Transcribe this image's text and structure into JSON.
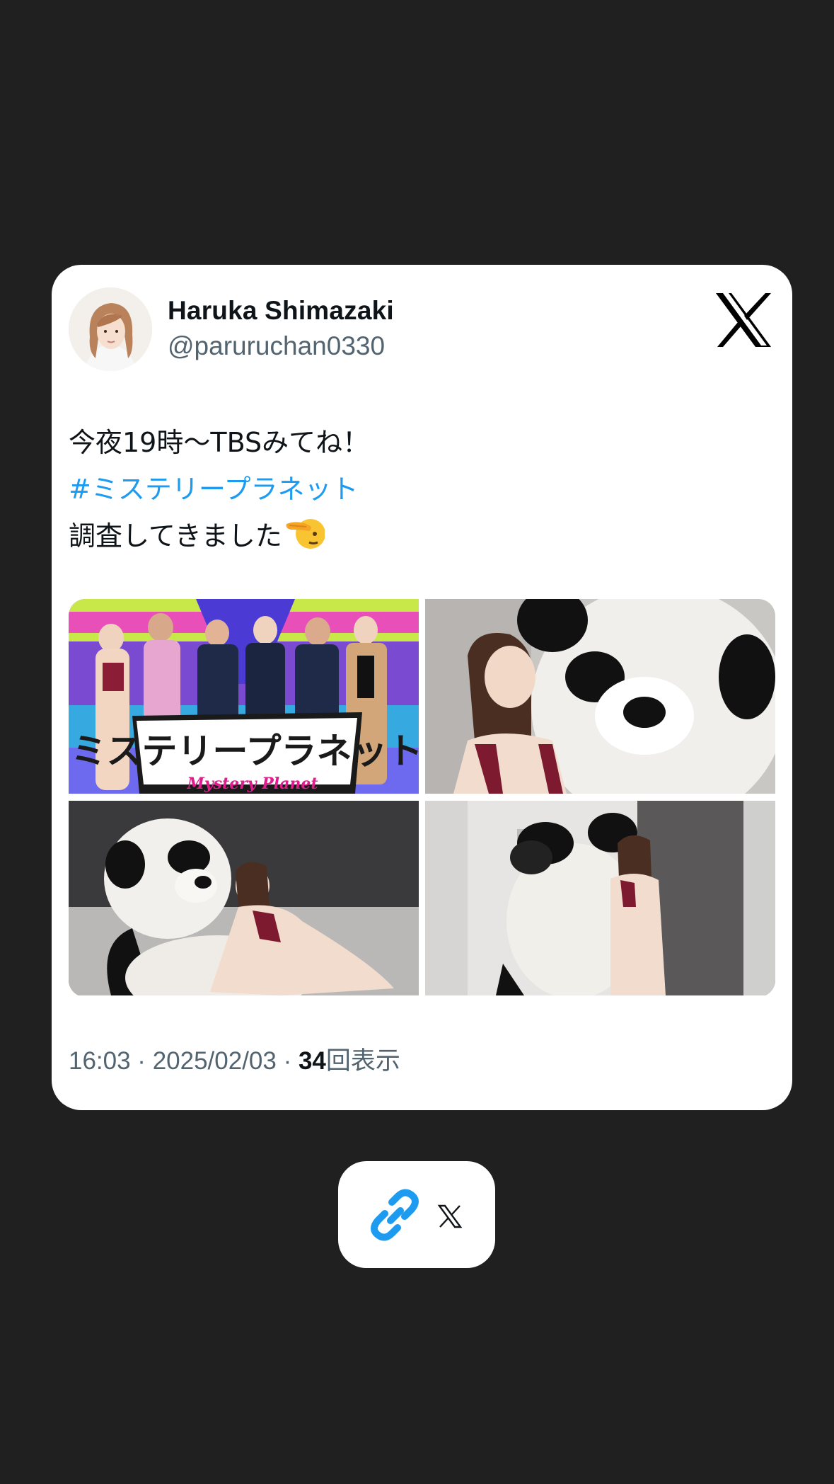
{
  "tweet": {
    "author_name": "Haruka Shimazaki",
    "author_handle": "@paruruchan0330",
    "text_line1": "今夜19時〜TBSみてね！",
    "hashtag": "#ミステリープラネット",
    "text_line3": "調査してきました",
    "emoji_icon": "saluting-face-icon",
    "media_logo_text_ja": "ミステリープラネット",
    "media_logo_text_en": "Mystery Planet",
    "timestamp": "16:03 · 2025/02/03 · ",
    "views_count": "34",
    "views_label": "回表示"
  },
  "icons": {
    "brand": "x-logo-icon",
    "share_link": "link-icon",
    "share_brand": "x-logo-icon"
  },
  "colors": {
    "background": "#202020",
    "card": "#ffffff",
    "hashtag": "#1d9bf0",
    "link_icon": "#1d9bf0",
    "secondary_text": "#536471"
  }
}
